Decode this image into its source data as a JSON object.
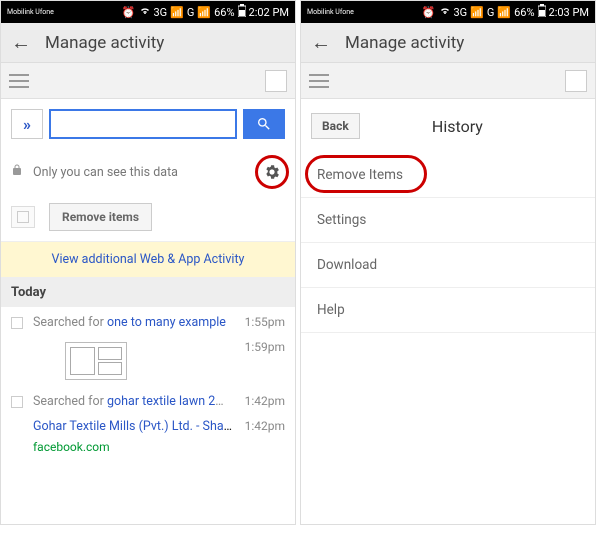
{
  "left": {
    "statusbar": {
      "carrier": "Mobilink\nUfone",
      "net": "3G",
      "netalt": "G",
      "battery": "66%",
      "time": "2:02 PM"
    },
    "appbar_title": "Manage activity",
    "search": {
      "placeholder": ""
    },
    "privacy_text": "Only you can see this data",
    "remove_items_label": "Remove items",
    "banner_label": "View additional Web & App Activity",
    "section": "Today",
    "entries": {
      "e1_prefix": "Searched for ",
      "e1_link": "one to many example",
      "e1_time": "1:55pm",
      "e2_time": "1:59pm",
      "e3_prefix": "Searched for ",
      "e3_link": "gohar textile lawn 2015",
      "e3_time": "1:42pm",
      "e4_link": "Gohar Textile Mills (Pvt.) Ltd. - Shah...",
      "e4_time": "1:42pm",
      "e4_domain": "facebook.com"
    }
  },
  "right": {
    "statusbar": {
      "carrier": "Mobilink\nUfone",
      "net": "3G",
      "netalt": "G",
      "battery": "66%",
      "time": "2:03 PM"
    },
    "appbar_title": "Manage activity",
    "back_label": "Back",
    "history_title": "History",
    "menu": {
      "remove": "Remove Items",
      "settings": "Settings",
      "download": "Download",
      "help": "Help"
    }
  }
}
